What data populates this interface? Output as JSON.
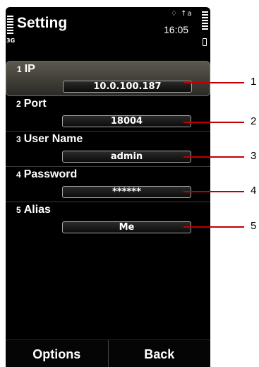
{
  "screen": {
    "title": "Setting",
    "time": "16:05",
    "network": "3G",
    "status_icons": "♢ ↑a"
  },
  "settings": [
    {
      "num": "1",
      "label": "IP",
      "value": "10.0.100.187"
    },
    {
      "num": "2",
      "label": "Port",
      "value": "18004"
    },
    {
      "num": "3",
      "label": "User Name",
      "value": "admin"
    },
    {
      "num": "4",
      "label": "Password",
      "value": "******"
    },
    {
      "num": "5",
      "label": "Alias",
      "value": "Me"
    }
  ],
  "softkeys": {
    "left": "Options",
    "right": "Back"
  },
  "callouts": [
    "1",
    "2",
    "3",
    "4",
    "5"
  ],
  "colors": {
    "background": "#000000",
    "callout_line": "#c00000",
    "selected_row": "#4a4640"
  }
}
